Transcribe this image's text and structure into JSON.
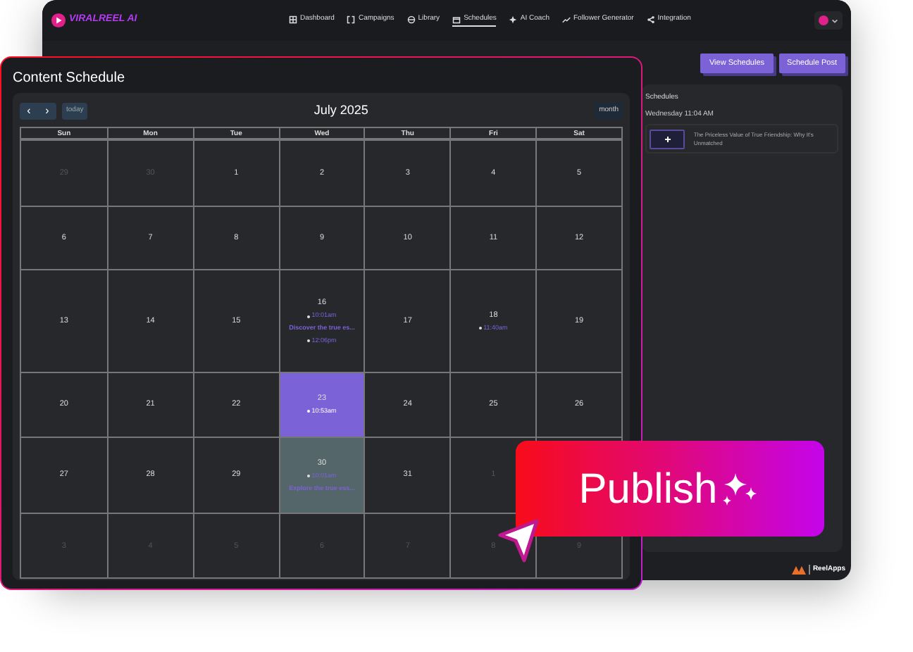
{
  "app": {
    "logo": "VIRALREEL AI",
    "nav": [
      {
        "label": "Dashboard",
        "selected": false
      },
      {
        "label": "Campaigns",
        "selected": false
      },
      {
        "label": "Library",
        "selected": false
      },
      {
        "label": "Schedules",
        "selected": true
      },
      {
        "label": "AI Coach",
        "selected": false
      },
      {
        "label": "Follower Generator",
        "selected": false
      },
      {
        "label": "Integration",
        "selected": false
      }
    ],
    "buttons": [
      "View Schedules",
      "Schedule Post"
    ],
    "schedules": {
      "title": "Schedules",
      "date": "Wednesday 11:04 AM",
      "items": [
        {
          "title": "The Priceless Value of True Friendship: Why It's Unmatched"
        }
      ]
    },
    "footer_brand": "ReelApps"
  },
  "panel": {
    "title": "Content Schedule",
    "calendar": {
      "prev": "‹",
      "next": "›",
      "today_button": "today",
      "title": "July 2025",
      "view_button": "month",
      "weekdays": [
        "Sun",
        "Mon",
        "Tue",
        "Wed",
        "Thu",
        "Fri",
        "Sat"
      ],
      "weeks": [
        [
          {
            "day": "29",
            "muted": true,
            "selected": false,
            "today": false
          },
          {
            "day": "30",
            "muted": true,
            "selected": false,
            "today": false
          },
          {
            "day": "1",
            "muted": false,
            "selected": false,
            "today": false
          },
          {
            "day": "2",
            "muted": false,
            "selected": false,
            "today": false
          },
          {
            "day": "3",
            "muted": false,
            "selected": false,
            "today": false
          },
          {
            "day": "4",
            "muted": false,
            "selected": false,
            "today": false
          },
          {
            "day": "5",
            "muted": false,
            "selected": false,
            "today": false
          }
        ],
        [
          {
            "day": "6",
            "muted": false,
            "selected": false,
            "today": false
          },
          {
            "day": "7",
            "muted": false,
            "selected": false,
            "today": false
          },
          {
            "day": "8",
            "muted": false,
            "selected": false,
            "today": false
          },
          {
            "day": "9",
            "muted": false,
            "selected": false,
            "today": false
          },
          {
            "day": "10",
            "muted": false,
            "selected": false,
            "today": false
          },
          {
            "day": "11",
            "muted": false,
            "selected": false,
            "today": false
          },
          {
            "day": "12",
            "muted": false,
            "selected": false,
            "today": false
          }
        ],
        [
          {
            "day": "13",
            "muted": false,
            "selected": false,
            "today": false
          },
          {
            "day": "14",
            "muted": false,
            "selected": false,
            "today": false
          },
          {
            "day": "15",
            "muted": false,
            "selected": false,
            "today": false
          },
          {
            "day": "16",
            "muted": false,
            "selected": false,
            "today": false,
            "events": [
              {
                "time": "10:01am",
                "title": "Discover the true es..."
              },
              {
                "time": "12:06pm"
              }
            ]
          },
          {
            "day": "17",
            "muted": false,
            "selected": false,
            "today": false
          },
          {
            "day": "18",
            "muted": false,
            "selected": false,
            "today": false,
            "events": [
              {
                "time": "11:40am"
              }
            ]
          },
          {
            "day": "19",
            "muted": false,
            "selected": false,
            "today": false
          }
        ],
        [
          {
            "day": "20",
            "muted": false,
            "selected": false,
            "today": false
          },
          {
            "day": "21",
            "muted": false,
            "selected": false,
            "today": false
          },
          {
            "day": "22",
            "muted": false,
            "selected": false,
            "today": false
          },
          {
            "day": "23",
            "muted": false,
            "selected": true,
            "today": false,
            "events": [
              {
                "time": "10:53am"
              }
            ]
          },
          {
            "day": "24",
            "muted": false,
            "selected": false,
            "today": false
          },
          {
            "day": "25",
            "muted": false,
            "selected": false,
            "today": false
          },
          {
            "day": "26",
            "muted": false,
            "selected": false,
            "today": false
          }
        ],
        [
          {
            "day": "27",
            "muted": false,
            "selected": false,
            "today": false
          },
          {
            "day": "28",
            "muted": false,
            "selected": false,
            "today": false
          },
          {
            "day": "29",
            "muted": false,
            "selected": false,
            "today": false
          },
          {
            "day": "30",
            "muted": false,
            "selected": false,
            "today": true,
            "events": [
              {
                "time": "10:01am",
                "title": "Explore the true ess..."
              }
            ]
          },
          {
            "day": "31",
            "muted": false,
            "selected": false,
            "today": false
          },
          {
            "day": "1",
            "muted": true,
            "selected": false,
            "today": false
          }
        ],
        [
          {
            "day": "3",
            "muted": true,
            "selected": false,
            "today": false
          },
          {
            "day": "4",
            "muted": true,
            "selected": false,
            "today": false
          },
          {
            "day": "5",
            "muted": true,
            "selected": false,
            "today": false
          },
          {
            "day": "6",
            "muted": true,
            "selected": false,
            "today": false
          },
          {
            "day": "7",
            "muted": true,
            "selected": false,
            "today": false
          },
          {
            "day": "8",
            "muted": true,
            "selected": false,
            "today": false
          },
          {
            "day": "9",
            "muted": true,
            "selected": false,
            "today": false
          }
        ]
      ]
    }
  },
  "publish": {
    "label": "Publish"
  }
}
